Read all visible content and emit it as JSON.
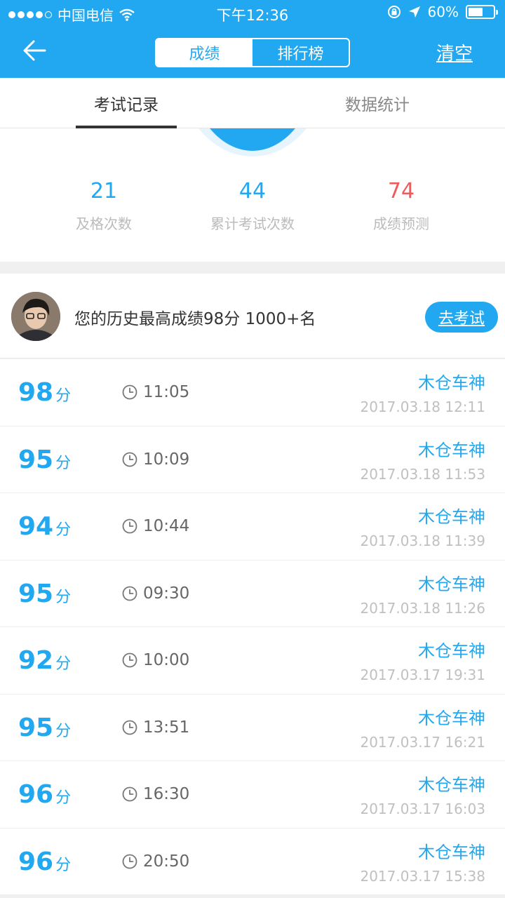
{
  "status_bar": {
    "carrier": "中国电信",
    "time": "下午12:36",
    "battery": "60%",
    "battery_level": 0.6
  },
  "nav": {
    "tabs": [
      "成绩",
      "排行榜"
    ],
    "active_tab": 0,
    "clear_label": "清空"
  },
  "sub_tabs": {
    "labels": [
      "考试记录",
      "数据统计"
    ],
    "active": 0
  },
  "stats": [
    {
      "value": "21",
      "label": "及格次数",
      "color": "#21a8f0"
    },
    {
      "value": "44",
      "label": "累计考试次数",
      "color": "#21a8f0"
    },
    {
      "value": "74",
      "label": "成绩预测",
      "color": "#f05a5a"
    }
  ],
  "best": {
    "text": "您的历史最高成绩98分 1000+名",
    "button_label": "去考试"
  },
  "records": [
    {
      "score": "98",
      "unit": "分",
      "duration": "11:05",
      "name": "木仓车神",
      "date": "2017.03.18 12:11"
    },
    {
      "score": "95",
      "unit": "分",
      "duration": "10:09",
      "name": "木仓车神",
      "date": "2017.03.18 11:53"
    },
    {
      "score": "94",
      "unit": "分",
      "duration": "10:44",
      "name": "木仓车神",
      "date": "2017.03.18 11:39"
    },
    {
      "score": "95",
      "unit": "分",
      "duration": "09:30",
      "name": "木仓车神",
      "date": "2017.03.18 11:26"
    },
    {
      "score": "92",
      "unit": "分",
      "duration": "10:00",
      "name": "木仓车神",
      "date": "2017.03.17 19:31"
    },
    {
      "score": "95",
      "unit": "分",
      "duration": "13:51",
      "name": "木仓车神",
      "date": "2017.03.17 16:21"
    },
    {
      "score": "96",
      "unit": "分",
      "duration": "16:30",
      "name": "木仓车神",
      "date": "2017.03.17 16:03"
    },
    {
      "score": "96",
      "unit": "分",
      "duration": "20:50",
      "name": "木仓车神",
      "date": "2017.03.17 15:38"
    }
  ],
  "icons": {
    "back": "back-arrow-icon",
    "clock": "clock-icon",
    "wifi": "wifi-icon",
    "location": "location-arrow-icon",
    "lock": "rotation-lock-icon"
  }
}
